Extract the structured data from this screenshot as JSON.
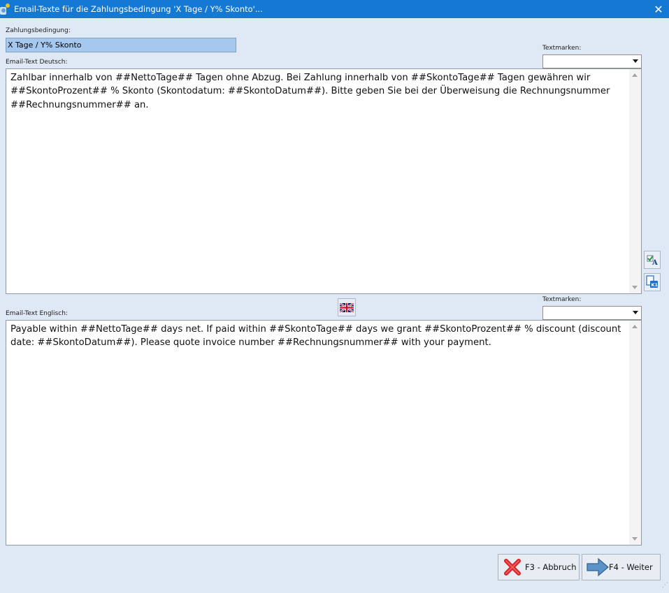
{
  "window": {
    "title": "Email-Texte für die Zahlungsbedingung 'X Tage / Y% Skonto'...",
    "close_glyph": "✕"
  },
  "zahlungsbedingung": {
    "label": "Zahlungsbedingung:",
    "value": "X Tage / Y% Skonto"
  },
  "deutsch": {
    "label": "Email-Text Deutsch:",
    "textmarken_label": "Textmarken:",
    "textmarken_value": "",
    "text": "Zahlbar innerhalb von ##NettoTage## Tagen ohne Abzug. Bei Zahlung innerhalb von ##SkontoTage## Tagen gewähren wir ##SkontoProzent## % Skonto (Skontodatum: ##SkontoDatum##). Bitte geben Sie bei der Überweisung die Rechnungsnummer ##Rechnungsnummer## an."
  },
  "englisch": {
    "label": "Email-Text Englisch:",
    "textmarken_label": "Textmarken:",
    "textmarken_value": "",
    "text": "Payable within ##NettoTage## days net. If paid within ##SkontoTage## days we grant ##SkontoProzent## % discount (discount date: ##SkontoDatum##). Please quote invoice number ##Rechnungsnummer## with your payment."
  },
  "buttons": {
    "cancel_label": "F3 - Abbruch",
    "next_label": "F4 - Weiter"
  },
  "icons": {
    "app": "app-icon",
    "spellcheck": "spellcheck-icon",
    "translate": "translate-icon",
    "flag": "uk-flag-icon",
    "cancel": "red-x-icon",
    "next": "arrow-right-icon"
  },
  "colors": {
    "titlebar": "#1479d4",
    "background": "#dfe9f5",
    "selection": "#a6c8ef"
  }
}
